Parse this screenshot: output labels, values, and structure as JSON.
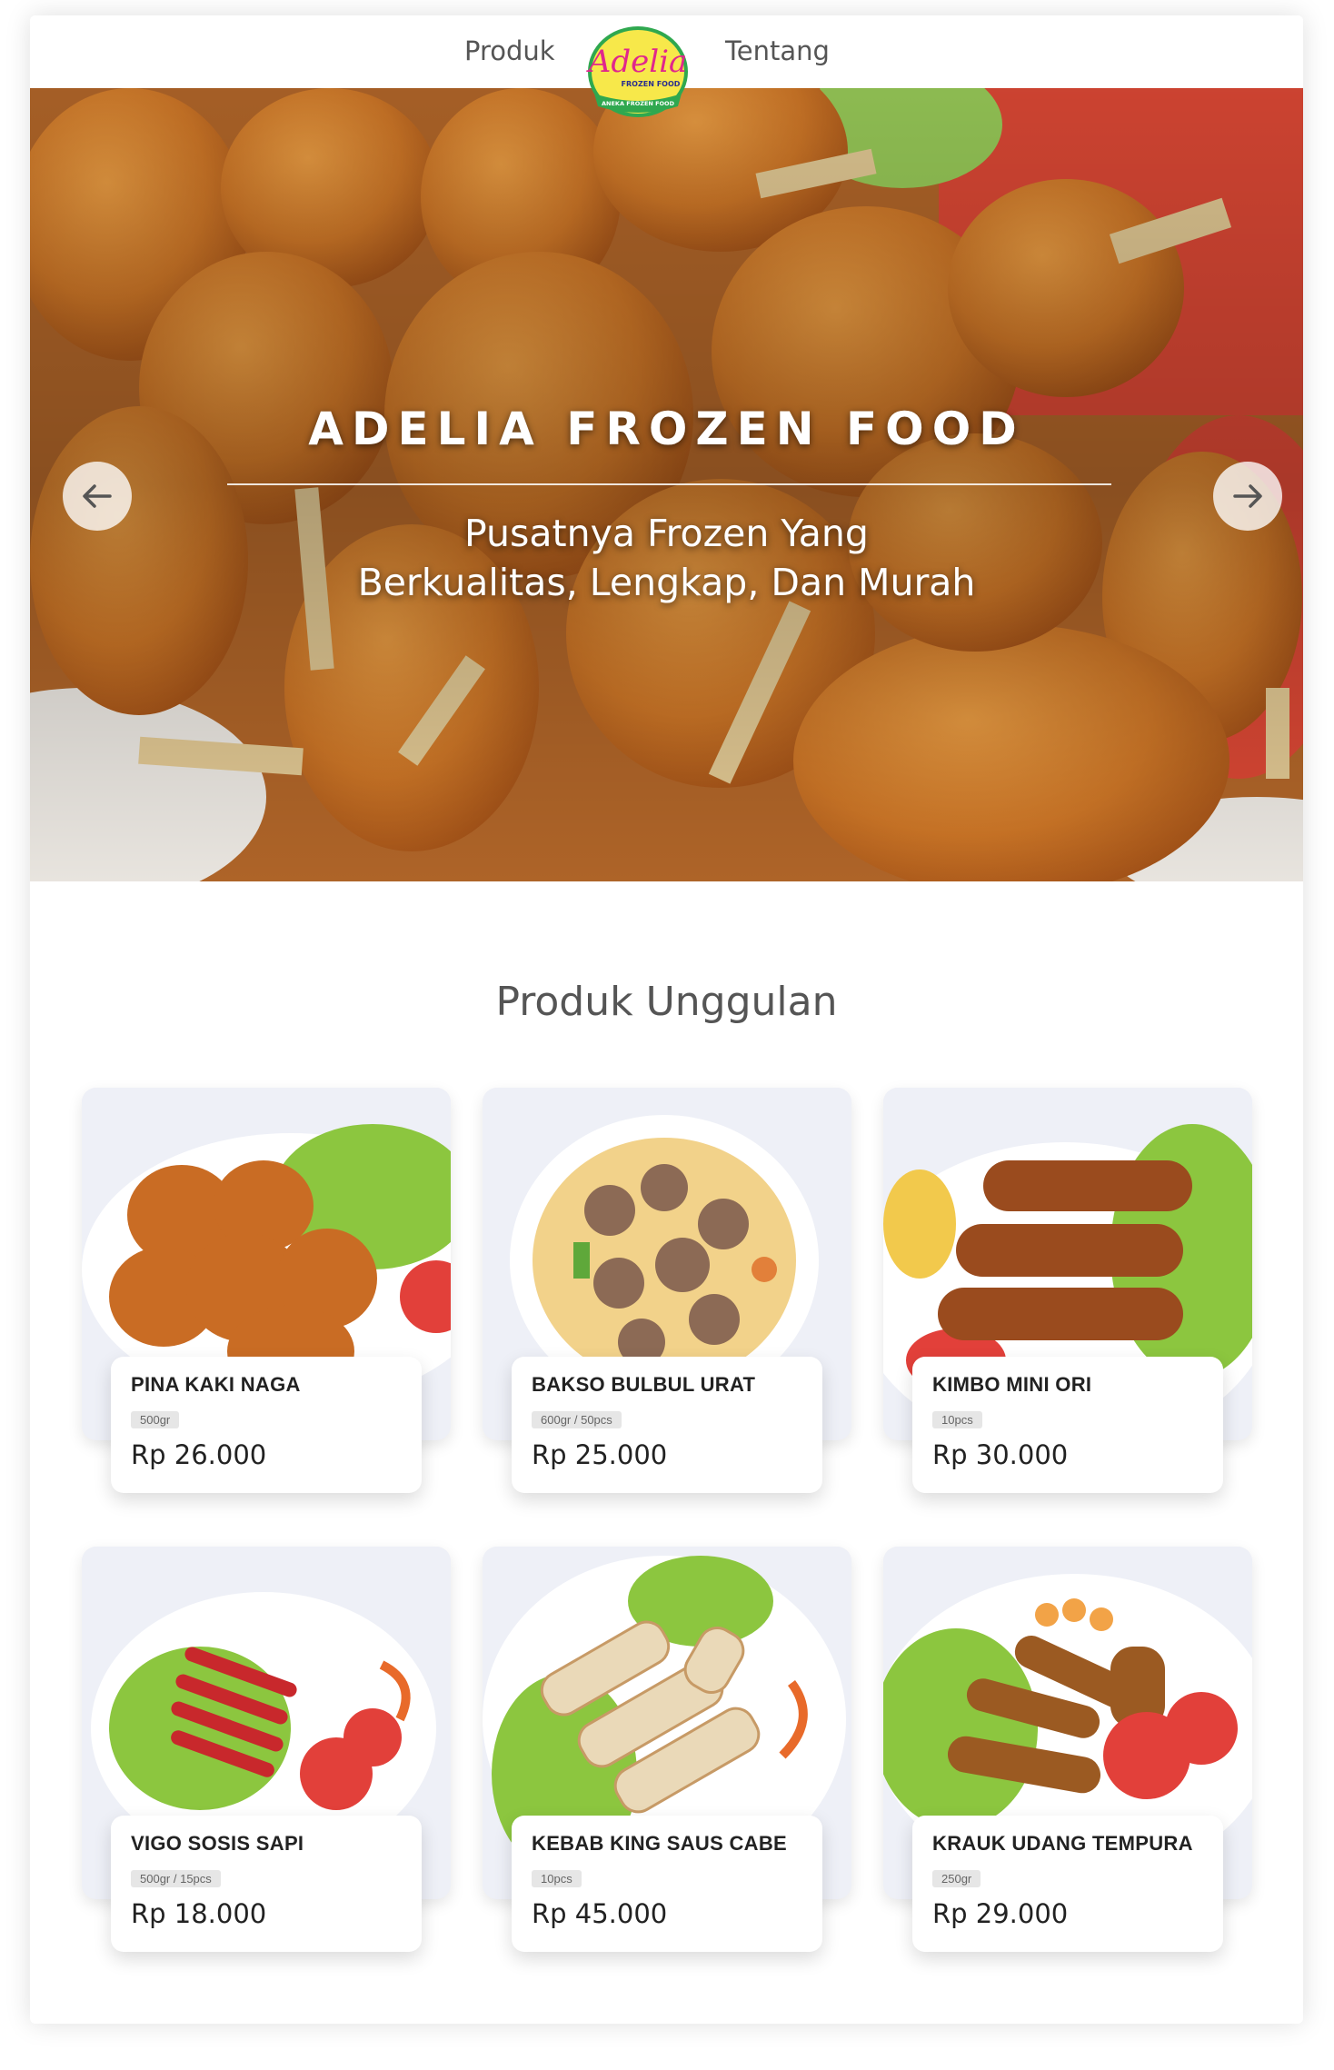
{
  "nav": {
    "left_link": "Produk",
    "right_link": "Tentang",
    "logo": {
      "script_text": "Adelia",
      "line1": "FROZEN FOOD",
      "ribbon": "ANEKA FROZEN FOOD"
    }
  },
  "hero": {
    "title": "ADELIA FROZEN FOOD",
    "subtitle_line1": "Pusatnya Frozen Yang",
    "subtitle_line2": "Berkualitas, Lengkap, Dan Murah",
    "prev_icon": "arrow-left-icon",
    "next_icon": "arrow-right-icon"
  },
  "section": {
    "title": "Produk Unggulan"
  },
  "products": [
    {
      "name": "PINA KAKI NAGA",
      "size": "500gr",
      "price": "Rp 26.000",
      "image": "fried-nuggets-plate"
    },
    {
      "name": "BAKSO BULBUL URAT",
      "size": "600gr / 50pcs",
      "price": "Rp 25.000",
      "image": "meatball-soup-bowl"
    },
    {
      "name": "KIMBO MINI ORI",
      "size": "10pcs",
      "price": "Rp 30.000",
      "image": "sausage-plate"
    },
    {
      "name": "VIGO SOSIS SAPI",
      "size": "500gr / 15pcs",
      "price": "Rp 18.000",
      "image": "red-sausage-plate"
    },
    {
      "name": "KEBAB KING SAUS CABE",
      "size": "10pcs",
      "price": "Rp 45.000",
      "image": "kebab-rolls-plate"
    },
    {
      "name": "KRAUK UDANG TEMPURA",
      "size": "250gr",
      "price": "Rp 29.000",
      "image": "shrimp-tempura-plate"
    }
  ],
  "colors": {
    "fried_orange": "#d9822b",
    "lettuce_green": "#8cc63f",
    "tomato_red": "#e2403a",
    "logo_yellow": "#f7e84a",
    "logo_green": "#2fa84f",
    "logo_pink": "#e0268c"
  }
}
